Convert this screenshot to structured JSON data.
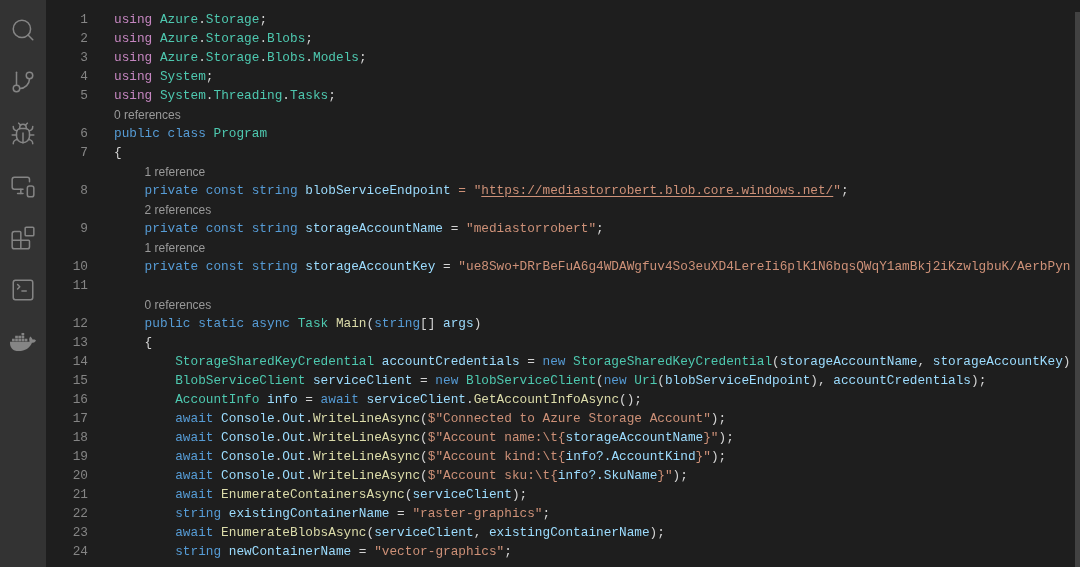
{
  "activity_bar": [
    {
      "kind": "search"
    },
    {
      "kind": "source-control"
    },
    {
      "kind": "run-debug"
    },
    {
      "kind": "remote"
    },
    {
      "kind": "extensions"
    },
    {
      "kind": "terminal"
    },
    {
      "kind": "docker"
    }
  ],
  "lines": [
    {
      "number": "1",
      "tokens": [
        {
          "t": "using",
          "kind": "control"
        },
        {
          "t": " Azure",
          "kind": "type"
        },
        {
          "t": ".",
          "kind": "plain"
        },
        {
          "t": "Storage",
          "kind": "type"
        },
        {
          "t": ";",
          "kind": "plain"
        }
      ]
    },
    {
      "number": "2",
      "tokens": [
        {
          "t": "using",
          "kind": "control"
        },
        {
          "t": " Azure",
          "kind": "type"
        },
        {
          "t": ".",
          "kind": "plain"
        },
        {
          "t": "Storage",
          "kind": "type"
        },
        {
          "t": ".",
          "kind": "plain"
        },
        {
          "t": "Blobs",
          "kind": "type"
        },
        {
          "t": ";",
          "kind": "plain"
        }
      ]
    },
    {
      "number": "3",
      "tokens": [
        {
          "t": "using",
          "kind": "control"
        },
        {
          "t": " Azure",
          "kind": "type"
        },
        {
          "t": ".",
          "kind": "plain"
        },
        {
          "t": "Storage",
          "kind": "type"
        },
        {
          "t": ".",
          "kind": "plain"
        },
        {
          "t": "Blobs",
          "kind": "type"
        },
        {
          "t": ".",
          "kind": "plain"
        },
        {
          "t": "Models",
          "kind": "type"
        },
        {
          "t": ";",
          "kind": "plain"
        }
      ]
    },
    {
      "number": "4",
      "tokens": [
        {
          "t": "using",
          "kind": "control"
        },
        {
          "t": " System",
          "kind": "type"
        },
        {
          "t": ";",
          "kind": "plain"
        }
      ]
    },
    {
      "number": "5",
      "tokens": [
        {
          "t": "using",
          "kind": "control"
        },
        {
          "t": " System",
          "kind": "type"
        },
        {
          "t": ".",
          "kind": "plain"
        },
        {
          "t": "Threading",
          "kind": "type"
        },
        {
          "t": ".",
          "kind": "plain"
        },
        {
          "t": "Tasks",
          "kind": "type"
        },
        {
          "t": ";",
          "kind": "plain"
        }
      ]
    },
    {
      "number": "6",
      "lens": "0 references",
      "tokens": [
        {
          "t": "public class",
          "kind": "keyword"
        },
        {
          "t": " Program",
          "kind": "type"
        }
      ]
    },
    {
      "number": "7",
      "tokens": [
        {
          "t": "{",
          "kind": "plain"
        }
      ]
    },
    {
      "number": "8",
      "lens": "1 reference",
      "tokens": [
        {
          "t": "    private const string",
          "kind": "keyword"
        },
        {
          "t": " blobServiceEndpoint",
          "kind": "variable"
        },
        {
          "t": " = \"",
          "kind": "string"
        },
        {
          "t": "https://mediastorrobert.blob.core.windows.net/",
          "kind": "link"
        },
        {
          "t": "\"",
          "kind": "string"
        },
        {
          "t": ";",
          "kind": "plain"
        }
      ]
    },
    {
      "number": "9",
      "lens": "2 references",
      "tokens": [
        {
          "t": "    private const string",
          "kind": "keyword"
        },
        {
          "t": " storageAccountName",
          "kind": "variable"
        },
        {
          "t": " =",
          "kind": "plain"
        },
        {
          "t": " \"mediastorrobert\"",
          "kind": "string"
        },
        {
          "t": ";",
          "kind": "plain"
        }
      ]
    },
    {
      "number": "10",
      "lens": "1 reference",
      "tokens": [
        {
          "t": "    private const string",
          "kind": "keyword"
        },
        {
          "t": " storageAccountKey",
          "kind": "variable"
        },
        {
          "t": " =",
          "kind": "plain"
        },
        {
          "t": " \"ue8Swo+DRrBeFuA6g4WDAWgfuv4So3euXD4LereIi6plK1N6bqsQWqY1amBkj2iKzwlgbuK/AerbPyn",
          "kind": "string"
        }
      ]
    },
    {
      "number": "11"
    },
    {
      "number": "12",
      "lens": "0 references",
      "tokens": [
        {
          "t": "    public static async",
          "kind": "keyword"
        },
        {
          "t": " Task",
          "kind": "type"
        },
        {
          "t": " Main",
          "kind": "method"
        },
        {
          "t": "(",
          "kind": "plain"
        },
        {
          "t": "string",
          "kind": "keyword"
        },
        {
          "t": "[]",
          "kind": "plain"
        },
        {
          "t": " args",
          "kind": "variable"
        },
        {
          "t": ")",
          "kind": "plain"
        }
      ]
    },
    {
      "number": "13",
      "tokens": [
        {
          "t": "    {",
          "kind": "plain"
        }
      ]
    },
    {
      "number": "14",
      "tokens": [
        {
          "t": "        StorageSharedKeyCredential",
          "kind": "type"
        },
        {
          "t": " accountCredentials",
          "kind": "variable"
        },
        {
          "t": " =",
          "kind": "plain"
        },
        {
          "t": " new",
          "kind": "keyword"
        },
        {
          "t": " StorageSharedKeyCredential",
          "kind": "type"
        },
        {
          "t": "(",
          "kind": "plain"
        },
        {
          "t": "storageAccountName",
          "kind": "variable"
        },
        {
          "t": ",",
          "kind": "plain"
        },
        {
          "t": " storageAccountKey",
          "kind": "variable"
        },
        {
          "t": ")",
          "kind": "plain"
        }
      ]
    },
    {
      "number": "15",
      "tokens": [
        {
          "t": "        BlobServiceClient",
          "kind": "type"
        },
        {
          "t": " serviceClient",
          "kind": "variable"
        },
        {
          "t": " =",
          "kind": "plain"
        },
        {
          "t": " new",
          "kind": "keyword"
        },
        {
          "t": " BlobServiceClient",
          "kind": "type"
        },
        {
          "t": "(",
          "kind": "plain"
        },
        {
          "t": "new",
          "kind": "keyword"
        },
        {
          "t": " Uri",
          "kind": "type"
        },
        {
          "t": "(",
          "kind": "plain"
        },
        {
          "t": "blobServiceEndpoint",
          "kind": "variable"
        },
        {
          "t": "),",
          "kind": "plain"
        },
        {
          "t": " accountCredentials",
          "kind": "variable"
        },
        {
          "t": ");",
          "kind": "plain"
        }
      ]
    },
    {
      "number": "16",
      "tokens": [
        {
          "t": "        AccountInfo",
          "kind": "type"
        },
        {
          "t": " info",
          "kind": "variable"
        },
        {
          "t": " =",
          "kind": "plain"
        },
        {
          "t": " await",
          "kind": "keyword"
        },
        {
          "t": " serviceClient",
          "kind": "variable"
        },
        {
          "t": ".",
          "kind": "plain"
        },
        {
          "t": "GetAccountInfoAsync",
          "kind": "method"
        },
        {
          "t": "();",
          "kind": "plain"
        }
      ]
    },
    {
      "number": "17",
      "tokens": [
        {
          "t": "        await",
          "kind": "keyword"
        },
        {
          "t": " Console",
          "kind": "variable"
        },
        {
          "t": ".",
          "kind": "plain"
        },
        {
          "t": "Out",
          "kind": "variable"
        },
        {
          "t": ".",
          "kind": "plain"
        },
        {
          "t": "WriteLineAsync",
          "kind": "method"
        },
        {
          "t": "(",
          "kind": "plain"
        },
        {
          "t": "$\"Connected to Azure Storage Account\"",
          "kind": "string"
        },
        {
          "t": ");",
          "kind": "plain"
        }
      ]
    },
    {
      "number": "18",
      "tokens": [
        {
          "t": "        await",
          "kind": "keyword"
        },
        {
          "t": " Console",
          "kind": "variable"
        },
        {
          "t": ".",
          "kind": "plain"
        },
        {
          "t": "Out",
          "kind": "variable"
        },
        {
          "t": ".",
          "kind": "plain"
        },
        {
          "t": "WriteLineAsync",
          "kind": "method"
        },
        {
          "t": "(",
          "kind": "plain"
        },
        {
          "t": "$\"Account name:\\t{",
          "kind": "string"
        },
        {
          "t": "storageAccountName",
          "kind": "variable"
        },
        {
          "t": "}\"",
          "kind": "string"
        },
        {
          "t": ");",
          "kind": "plain"
        }
      ]
    },
    {
      "number": "19",
      "tokens": [
        {
          "t": "        await",
          "kind": "keyword"
        },
        {
          "t": " Console",
          "kind": "variable"
        },
        {
          "t": ".",
          "kind": "plain"
        },
        {
          "t": "Out",
          "kind": "variable"
        },
        {
          "t": ".",
          "kind": "plain"
        },
        {
          "t": "WriteLineAsync",
          "kind": "method"
        },
        {
          "t": "(",
          "kind": "plain"
        },
        {
          "t": "$\"Account kind:\\t{",
          "kind": "string"
        },
        {
          "t": "info?.AccountKind",
          "kind": "variable"
        },
        {
          "t": "}\"",
          "kind": "string"
        },
        {
          "t": ");",
          "kind": "plain"
        }
      ]
    },
    {
      "number": "20",
      "tokens": [
        {
          "t": "        await",
          "kind": "keyword"
        },
        {
          "t": " Console",
          "kind": "variable"
        },
        {
          "t": ".",
          "kind": "plain"
        },
        {
          "t": "Out",
          "kind": "variable"
        },
        {
          "t": ".",
          "kind": "plain"
        },
        {
          "t": "WriteLineAsync",
          "kind": "method"
        },
        {
          "t": "(",
          "kind": "plain"
        },
        {
          "t": "$\"Account sku:\\t{",
          "kind": "string"
        },
        {
          "t": "info?.SkuName",
          "kind": "variable"
        },
        {
          "t": "}\"",
          "kind": "string"
        },
        {
          "t": ");",
          "kind": "plain"
        }
      ]
    },
    {
      "number": "21",
      "tokens": [
        {
          "t": "        await",
          "kind": "keyword"
        },
        {
          "t": " EnumerateContainersAsync",
          "kind": "method"
        },
        {
          "t": "(",
          "kind": "plain"
        },
        {
          "t": "serviceClient",
          "kind": "variable"
        },
        {
          "t": ");",
          "kind": "plain"
        }
      ]
    },
    {
      "number": "22",
      "tokens": [
        {
          "t": "        string",
          "kind": "keyword"
        },
        {
          "t": " existingContainerName",
          "kind": "variable"
        },
        {
          "t": " =",
          "kind": "plain"
        },
        {
          "t": " \"raster-graphics\"",
          "kind": "string"
        },
        {
          "t": ";",
          "kind": "plain"
        }
      ]
    },
    {
      "number": "23",
      "tokens": [
        {
          "t": "        await",
          "kind": "keyword"
        },
        {
          "t": " EnumerateBlobsAsync",
          "kind": "method"
        },
        {
          "t": "(",
          "kind": "plain"
        },
        {
          "t": "serviceClient",
          "kind": "variable"
        },
        {
          "t": ",",
          "kind": "plain"
        },
        {
          "t": " existingContainerName",
          "kind": "variable"
        },
        {
          "t": ");",
          "kind": "plain"
        }
      ]
    },
    {
      "number": "24",
      "tokens": [
        {
          "t": "        string",
          "kind": "keyword"
        },
        {
          "t": " newContainerName",
          "kind": "variable"
        },
        {
          "t": " =",
          "kind": "plain"
        },
        {
          "t": " \"vector-graphics\"",
          "kind": "string"
        },
        {
          "t": ";",
          "kind": "plain"
        }
      ]
    }
  ]
}
